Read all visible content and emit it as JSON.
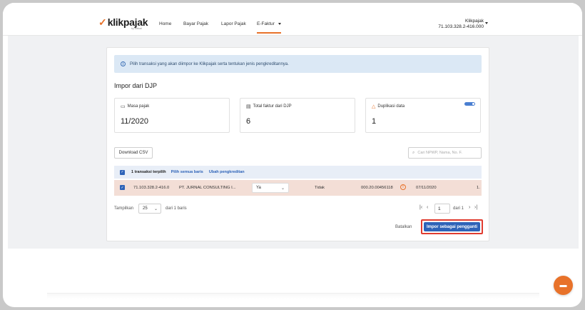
{
  "brand": {
    "logo": "klikpajak",
    "logo_sub": "by Mekari"
  },
  "nav": {
    "home": "Home",
    "bayar": "Bayar Pajak",
    "lapor": "Lapor Pajak",
    "efaktur": "E-Faktur"
  },
  "user": {
    "name": "Klikpajak",
    "npwp": "71.103.328.2-416.000"
  },
  "info": {
    "text": "Pilih transaksi yang akan diimpor ke Klikpajak serta tentukan jenis pengkreditannya."
  },
  "page_title": "Impor dari DJP",
  "stats": [
    {
      "label": "Masa pajak",
      "value": "11/2020"
    },
    {
      "label": "Total faktur dari DJP",
      "value": "6"
    },
    {
      "label": "Duplikasi data",
      "value": "1"
    }
  ],
  "toolbar": {
    "download_csv": "Download CSV",
    "search_placeholder": "Cari NPWP, Nama, No. F."
  },
  "table_head": {
    "count": "1 transaksi terpilih",
    "select_all": "Pilih semua baris",
    "change_credit": "Ubah pengkreditan"
  },
  "row": {
    "npwp": "71.103.328.2-416.0",
    "name": "PT. JURNAL CONSULTING I...",
    "credit": "Ya",
    "status": "Tidak",
    "faktur": "000.20.00456118",
    "date": "07/11/2020",
    "extra": "1."
  },
  "pager": {
    "show_label": "Tampilkan",
    "per_page": "25",
    "of_rows": "dari 1 baris",
    "page": "1",
    "of_pages": "dari  1"
  },
  "actions": {
    "cancel": "Batalkan",
    "import": "Impor sebagai pengganti"
  },
  "colors": {
    "brand_orange": "#e8722a",
    "primary_blue": "#2e63b8",
    "highlight_red": "#e03b2f"
  }
}
